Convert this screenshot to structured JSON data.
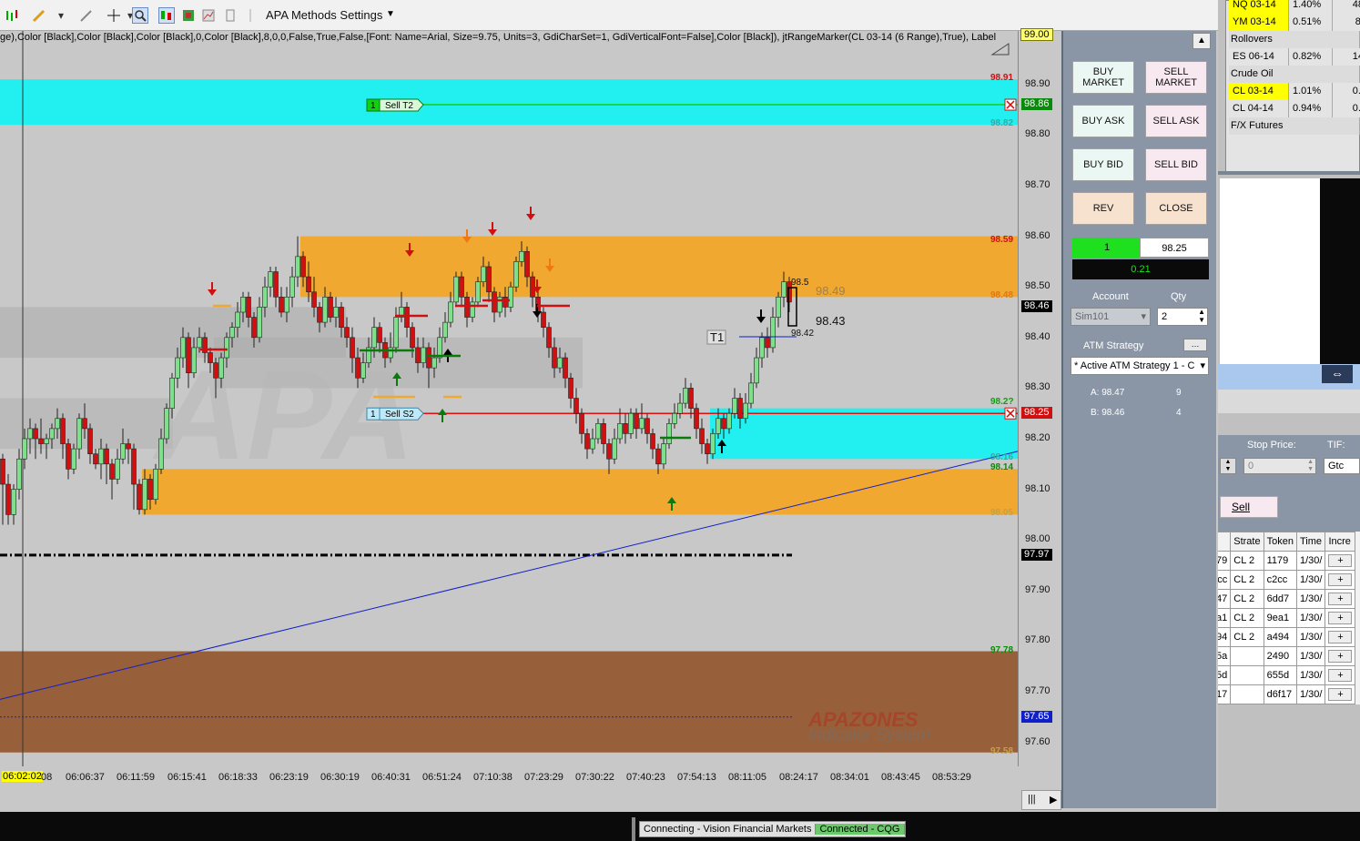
{
  "toolbar": {
    "settings_label": "APA Methods Settings",
    "tools": [
      "bar-chart-icon",
      "pencil-icon",
      "wand-icon",
      "crosshair-icon",
      "zoom-icon",
      "chart-style-icon",
      "data-series-icon",
      "indicator-icon",
      "strategy-icon"
    ]
  },
  "chart": {
    "params_text": "ge),Color [Black],Color [Black],Color [Black],0,Color [Black],8,0,0,False,True,False,[Font: Name=Arial, Size=9.75, Units=3, GdiCharSet=1, GdiVerticalFont=False],Color [Black]), jtRangeMarker(CL 03-14 (6 Range),True), Label",
    "top_tag": "99.00",
    "y_ticks": [
      "98.90",
      "98.80",
      "98.70",
      "98.60",
      "98.50",
      "98.40",
      "98.30",
      "98.20",
      "98.10",
      "98.00",
      "97.90",
      "97.80",
      "97.70",
      "97.60"
    ],
    "price_tags": [
      {
        "value": "98.86",
        "color": "#0a8a0a"
      },
      {
        "value": "98.46",
        "color": "#000000"
      },
      {
        "value": "98.25",
        "color": "#d01010"
      },
      {
        "value": "97.97",
        "color": "#000000"
      },
      {
        "value": "97.65",
        "color": "#1020c8"
      }
    ],
    "zone_labels": [
      {
        "text": "98.91",
        "color": "#d01010"
      },
      {
        "text": "98.82",
        "color": "#39a8a8"
      },
      {
        "text": "98.59",
        "color": "#d01010"
      },
      {
        "text": "98.48",
        "color": "#e07810"
      },
      {
        "text": "98.2?",
        "color": "#10a010"
      },
      {
        "text": "98.16",
        "color": "#39a8a8"
      },
      {
        "text": "98.14",
        "color": "#0a8a0a"
      },
      {
        "text": "98.05",
        "color": "#c8a040"
      },
      {
        "text": "97.78",
        "color": "#0a8a0a"
      },
      {
        "text": "97.58",
        "color": "#c8a040"
      }
    ],
    "x_labels": [
      "06:06:37",
      "06:11:59",
      "06:15:41",
      "06:18:33",
      "06:23:19",
      "06:30:19",
      "06:40:31",
      "06:51:24",
      "07:10:38",
      "07:23:29",
      "07:30:22",
      "07:40:23",
      "07:54:13",
      "08:11:05",
      "08:24:17",
      "08:34:01",
      "08:43:45",
      "08:53:29"
    ],
    "current_time": "06:02:02",
    "cut_time_label": "08",
    "orders": {
      "sell_t2": {
        "qty": "1",
        "label": "Sell T2"
      },
      "sell_s2": {
        "qty": "1",
        "label": "Sell S2"
      }
    },
    "annotations": {
      "t1": "T1",
      "last_high": "98.5",
      "last_low": "98.42",
      "ghost_price": "98.49",
      "mid_price": "98.43"
    },
    "watermark": {
      "brand": "APAZONES",
      "tagline": "Indicator System"
    }
  },
  "panel": {
    "buttons": {
      "buy_market": "BUY MARKET",
      "sell_market": "SELL MARKET",
      "buy_ask": "BUY ASK",
      "sell_ask": "SELL ASK",
      "buy_bid": "BUY BID",
      "sell_bid": "SELL BID",
      "rev": "REV",
      "close": "CLOSE"
    },
    "position": {
      "qty": "1",
      "avg_price": "98.25",
      "pnl": "0.21"
    },
    "account_label": "Account",
    "qty_label": "Qty",
    "account_value": "Sim101",
    "qty_value": "2",
    "atm_label": "ATM Strategy",
    "atm_value": "* Active ATM Strategy 1 - C",
    "ask_label": "A: 98.47",
    "ask_size": "9",
    "bid_label": "B: 98.46",
    "bid_size": "4"
  },
  "market": {
    "rows": [
      {
        "sym": "NQ 03-14",
        "chg": "1.40%",
        "last": "48.",
        "hl": true
      },
      {
        "sym": "YM 03-14",
        "chg": "0.51%",
        "last": "80",
        "hl": true
      },
      {
        "sym": "Rollovers",
        "header": true
      },
      {
        "sym": "ES 06-14",
        "chg": "0.82%",
        "last": "14.",
        "hl": false
      },
      {
        "sym": "Crude Oil",
        "header": true
      },
      {
        "sym": "CL 03-14",
        "chg": "1.01%",
        "last": "0.9",
        "hl": true
      },
      {
        "sym": "CL 04-14",
        "chg": "0.94%",
        "last": "0.9",
        "hl": false
      },
      {
        "sym": "F/X Futures",
        "header": true
      }
    ]
  },
  "order_entry": {
    "stop_price_label": "Stop Price:",
    "stop_price_value": "0",
    "tif_label": "TIF:",
    "tif_value": "Gtc",
    "sell_button": "Sell"
  },
  "orders_table": {
    "headers": [
      "Strate",
      "Token",
      "Time",
      "Incre"
    ],
    "rows": [
      {
        "id": "79",
        "strategy": "CL 2",
        "token": "1179",
        "time": "1/30/"
      },
      {
        "id": "cc",
        "strategy": "CL 2",
        "token": "c2cc",
        "time": "1/30/"
      },
      {
        "id": "47",
        "strategy": "CL 2",
        "token": "6dd7",
        "time": "1/30/"
      },
      {
        "id": "a1",
        "strategy": "CL 2",
        "token": "9ea1",
        "time": "1/30/"
      },
      {
        "id": "94",
        "strategy": "CL 2",
        "token": "a494",
        "time": "1/30/"
      },
      {
        "id": "5a",
        "strategy": "",
        "token": "2490",
        "time": "1/30/"
      },
      {
        "id": "5d",
        "strategy": "",
        "token": "655d",
        "time": "1/30/"
      },
      {
        "id": "17",
        "strategy": "",
        "token": "d6f17",
        "time": "1/30/"
      }
    ],
    "incr_symbol": "+"
  },
  "status": {
    "connecting": "Connecting - Vision Financial Markets",
    "connected": "Connected - CQG"
  },
  "colors": {
    "cyan_zone": "#22f0f0",
    "orange_zone": "#f0a830",
    "brown_zone": "#98603a",
    "up_candle": "#7ee08a",
    "down_candle": "#d01010"
  }
}
